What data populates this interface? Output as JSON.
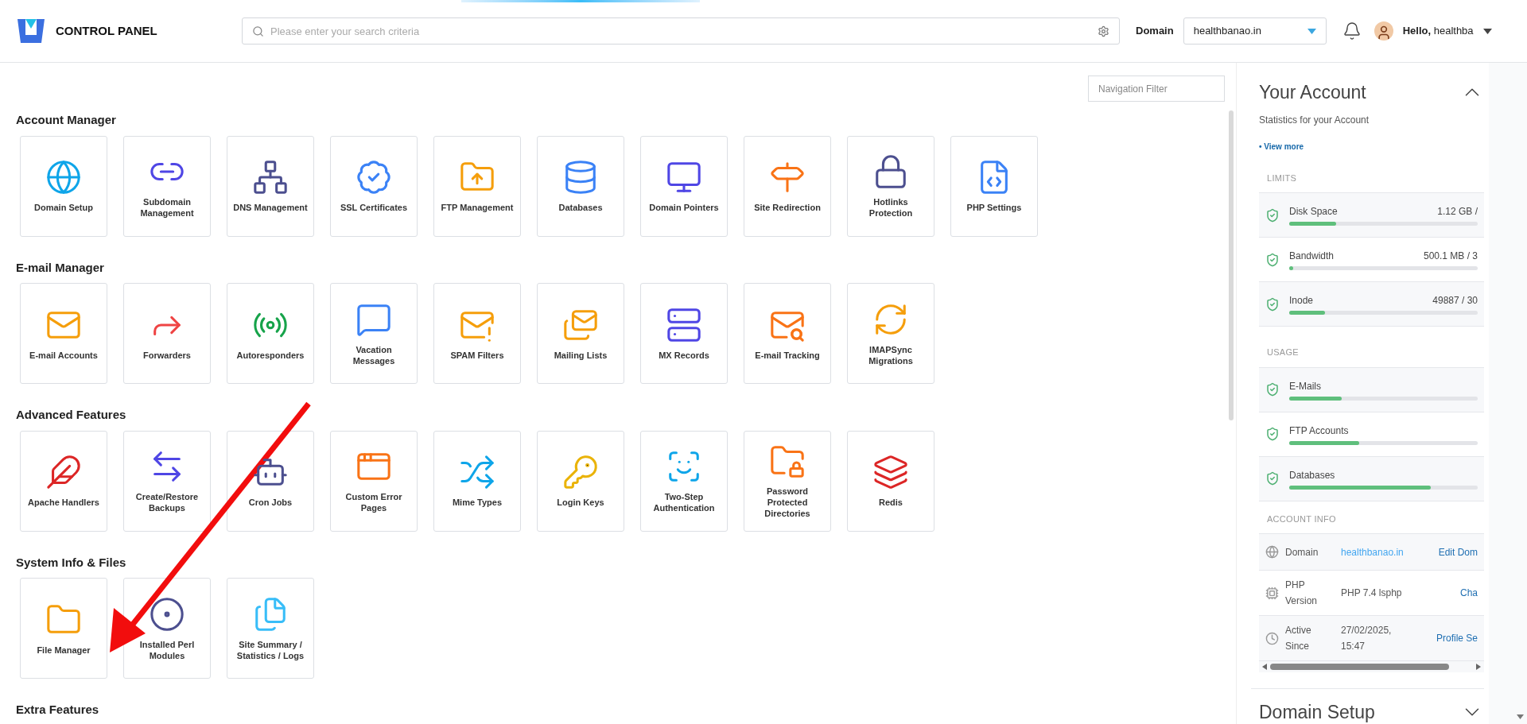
{
  "header": {
    "logo_text": "CONTROL PANEL",
    "search": {
      "placeholder": "Please enter your search criteria"
    },
    "domain_label": "Domain",
    "domain_select": {
      "value": "healthbanao.in"
    },
    "greeting": "**Hello,** healthba"
  },
  "navigation_filter": {
    "placeholder": "Navigation Filter"
  },
  "sections": [
    {
      "title": "Account Manager",
      "items": [
        {
          "label": "Domain Setup"
        },
        {
          "label": "Subdomain Management"
        },
        {
          "label": "DNS Management"
        },
        {
          "label": "SSL Certificates"
        },
        {
          "label": "FTP Management"
        },
        {
          "label": "Databases"
        },
        {
          "label": "Domain Pointers"
        },
        {
          "label": "Site Redirection"
        },
        {
          "label": "Hotlinks Protection"
        },
        {
          "label": "PHP Settings"
        }
      ]
    },
    {
      "title": "E-mail Manager",
      "items": [
        {
          "label": "E-mail Accounts"
        },
        {
          "label": "Forwarders"
        },
        {
          "label": "Autoresponders"
        },
        {
          "label": "Vacation Messages"
        },
        {
          "label": "SPAM Filters"
        },
        {
          "label": "Mailing Lists"
        },
        {
          "label": "MX Records"
        },
        {
          "label": "E-mail Tracking"
        },
        {
          "label": "IMAPSync Migrations"
        }
      ]
    },
    {
      "title": "Advanced Features",
      "items": [
        {
          "label": "Apache Handlers"
        },
        {
          "label": "Create/Restore Backups"
        },
        {
          "label": "Cron Jobs"
        },
        {
          "label": "Custom Error Pages"
        },
        {
          "label": "Mime Types"
        },
        {
          "label": "Login Keys"
        },
        {
          "label": "Two-Step Authentication"
        },
        {
          "label": "Password Protected Directories"
        },
        {
          "label": "Redis"
        }
      ]
    },
    {
      "title": "System Info & Files",
      "items": [
        {
          "label": "File Manager"
        },
        {
          "label": "Installed Perl Modules"
        },
        {
          "label": "Site Summary / Statistics / Logs"
        }
      ]
    },
    {
      "title": "Extra Features"
    }
  ],
  "account_panel": {
    "title": "Your Account",
    "expanded": true,
    "subtitle": "Statistics for your Account",
    "view_more": "• View more",
    "groups": [
      {
        "title": "LIMITS",
        "rows": [
          {
            "name": "Disk Space",
            "reading": "1.12 GB /",
            "level": 0.25
          },
          {
            "name": "Bandwidth",
            "reading": "500.1 MB / 3",
            "level": 0.02
          },
          {
            "name": "Inode",
            "reading": "49887 / 30",
            "level": 0.19
          }
        ]
      },
      {
        "title": "USAGE",
        "rows": [
          {
            "name": "E-Mails",
            "level": 0.28
          },
          {
            "name": "FTP Accounts",
            "level": 0.37
          },
          {
            "name": "Databases",
            "level": 0.75
          }
        ]
      }
    ],
    "info_title": "ACCOUNT INFO",
    "info_rows": [
      {
        "kind": "globe",
        "label": "Domain",
        "value": "healthbanao.in",
        "value_link": true,
        "action": "Edit Dom"
      },
      {
        "kind": "chip",
        "label": "PHP Version",
        "value": "PHP 7.4 lsphp",
        "value_link": false,
        "action": "Cha"
      },
      {
        "kind": "clock",
        "label": "Active Since",
        "value": "27/02/2025, 15:47",
        "value_link": false,
        "action": "Profile Se"
      }
    ]
  },
  "domain_panel": {
    "title": "Domain Setup",
    "expanded": false
  }
}
